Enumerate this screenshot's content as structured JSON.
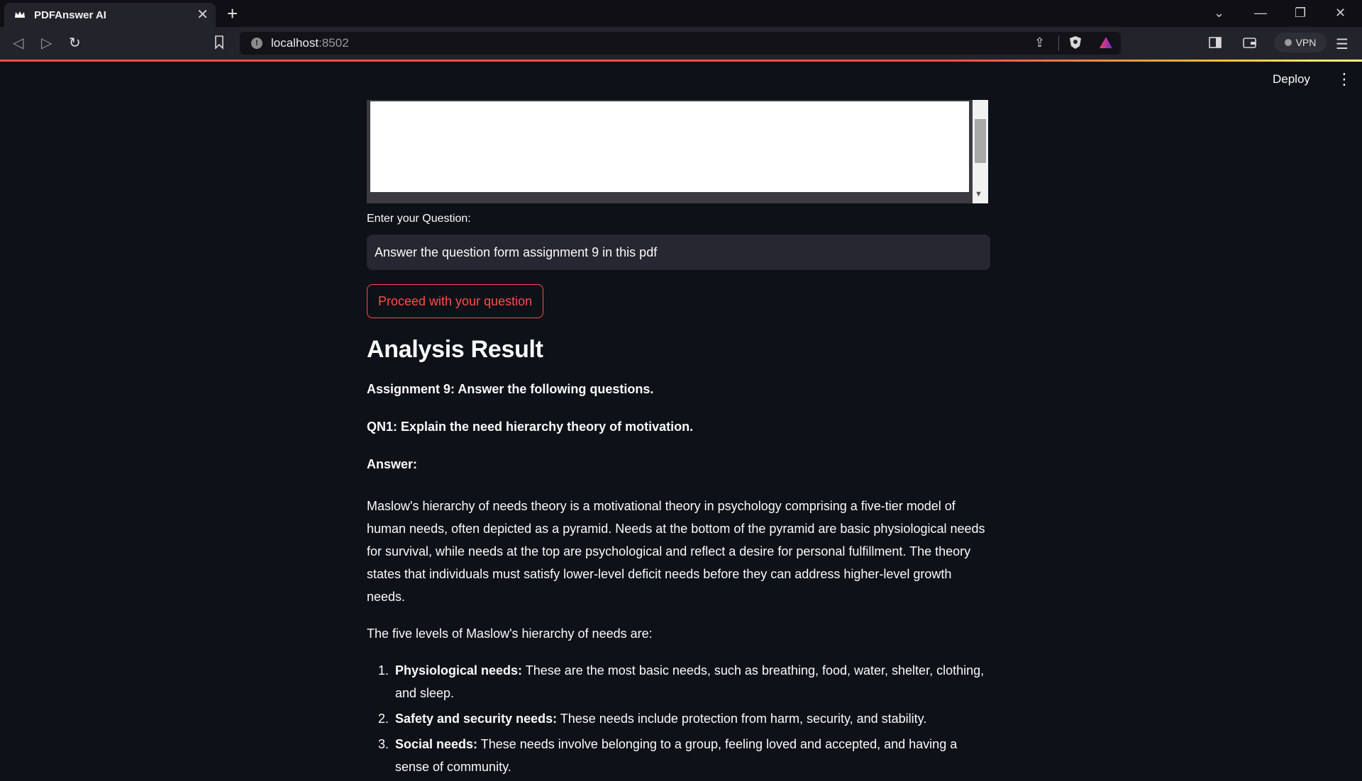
{
  "browser": {
    "tab_title": "PDFAnswer AI",
    "url_host": "localhost",
    "url_port": ":8502",
    "vpn_label": "VPN"
  },
  "app": {
    "deploy_label": "Deploy",
    "question_label": "Enter your Question:",
    "question_value": "Answer the question form assignment 9 in this pdf",
    "proceed_button": "Proceed with your question",
    "result_heading": "Analysis Result",
    "assignment_title": "Assignment 9: Answer the following questions.",
    "qn1": "QN1: Explain the need hierarchy theory of motivation.",
    "answer_label": "Answer:",
    "paragraph1": "Maslow's hierarchy of needs theory is a motivational theory in psychology comprising a five-tier model of human needs, often depicted as a pyramid. Needs at the bottom of the pyramid are basic physiological needs for survival, while needs at the top are psychological and reflect a desire for personal fulfillment. The theory states that individuals must satisfy lower-level deficit needs before they can address higher-level growth needs.",
    "paragraph2": "The five levels of Maslow's hierarchy of needs are:",
    "levels": [
      {
        "term": "Physiological needs:",
        "text": " These are the most basic needs, such as breathing, food, water, shelter, clothing, and sleep."
      },
      {
        "term": "Safety and security needs:",
        "text": " These needs include protection from harm, security, and stability."
      },
      {
        "term": "Social needs:",
        "text": " These needs involve belonging to a group, feeling loved and accepted, and having a sense of community."
      }
    ]
  },
  "colors": {
    "background": "#0e1117",
    "accent": "#ff4b4b",
    "input_bg": "#262730"
  }
}
